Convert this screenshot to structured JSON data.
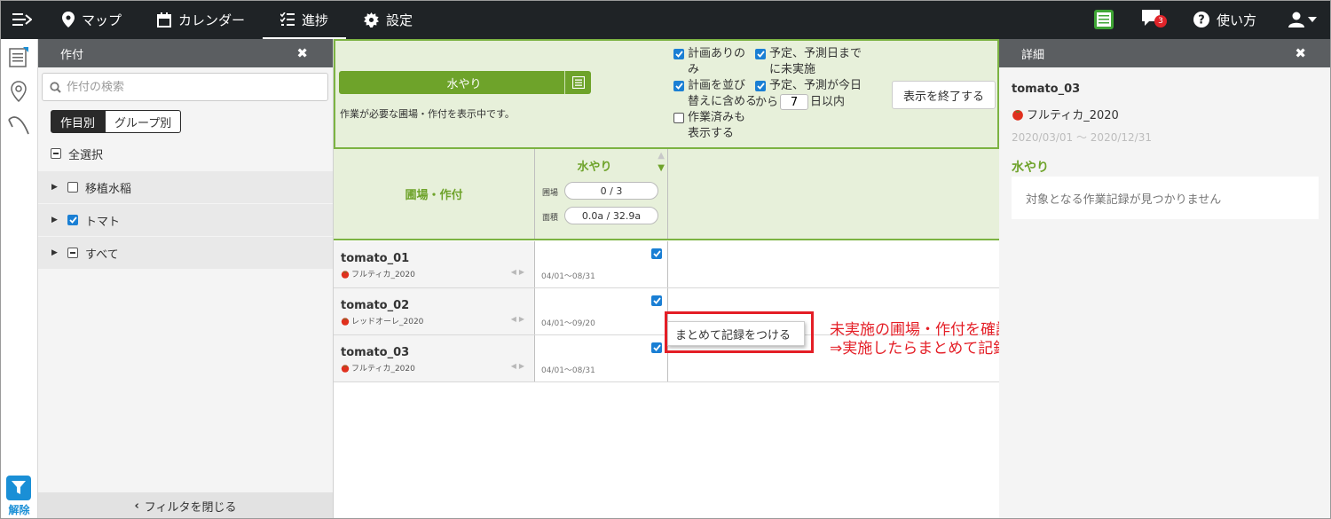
{
  "nav": {
    "items": [
      {
        "label": "マップ",
        "icon": "map-pin-icon"
      },
      {
        "label": "カレンダー",
        "icon": "calendar-icon"
      },
      {
        "label": "進捗",
        "icon": "checklist-icon"
      },
      {
        "label": "設定",
        "icon": "gear-icon"
      }
    ],
    "active": "進捗",
    "book_icon_text": "農作業\n記録",
    "notifications_count": "3",
    "help_label": "使い方"
  },
  "strip": {
    "filter_label": "解除"
  },
  "filter_panel": {
    "title": "作付",
    "search_placeholder": "作付の検索",
    "seg_by_crop": "作目別",
    "seg_by_group": "グループ別",
    "select_all": "全選択",
    "tree": [
      {
        "label": "移植水稲",
        "state": "unchecked"
      },
      {
        "label": "トマト",
        "state": "checked"
      },
      {
        "label": "すべて",
        "state": "indeterminate"
      }
    ],
    "close_filter": "フィルタを閉じる"
  },
  "center": {
    "task_button": "水やり",
    "note": "作業が必要な圃場・作付を表示中です。",
    "opt_plan_only": "計画ありのみ",
    "opt_plan_only_l1": "計画ありの",
    "opt_plan_only_l2": "み",
    "opt_sort_l1": "計画を並び",
    "opt_sort_l2": "替えに含める",
    "opt_done_l1": "作業済みも",
    "opt_done_l2": "表示する",
    "opt_pending_l1": "予定、予測日まで",
    "opt_pending_l2": "に未実施",
    "opt_today_l1": "予定、予測が今日",
    "opt_today_from": "から",
    "opt_today_days": "7",
    "opt_today_within": "日以内",
    "end_button": "表示を終了する",
    "col_field": "圃場・作付",
    "col_task": "水やり",
    "label_field": "圃場",
    "label_area": "面積",
    "field_count": "0 / 3",
    "area_value": "0.0a / 32.9a",
    "rows": [
      {
        "name": "tomato_01",
        "crop": "フルティカ_2020",
        "date": "04/01～08/31"
      },
      {
        "name": "tomato_02",
        "crop": "レッドオーレ_2020",
        "date": "04/01～09/20"
      },
      {
        "name": "tomato_03",
        "crop": "フルティカ_2020",
        "date": "04/01～08/31"
      }
    ],
    "context_menu": "まとめて記録をつける",
    "annotation_l1": "未実施の圃場・作付を確認",
    "annotation_l2": "⇒実施したらまとめて記録作成へ"
  },
  "detail_panel": {
    "title": "詳細",
    "name": "tomato_03",
    "crop": "フルティカ_2020",
    "period": "2020/03/01 ～ 2020/12/31",
    "task": "水やり",
    "empty": "対象となる作業記録が見つかりません"
  },
  "colors": {
    "nav_bg": "#1f2326",
    "green": "#6ea32a",
    "light_green": "#e7f0da",
    "annotation_red": "#e41e26",
    "check_blue": "#1a7fd4"
  }
}
